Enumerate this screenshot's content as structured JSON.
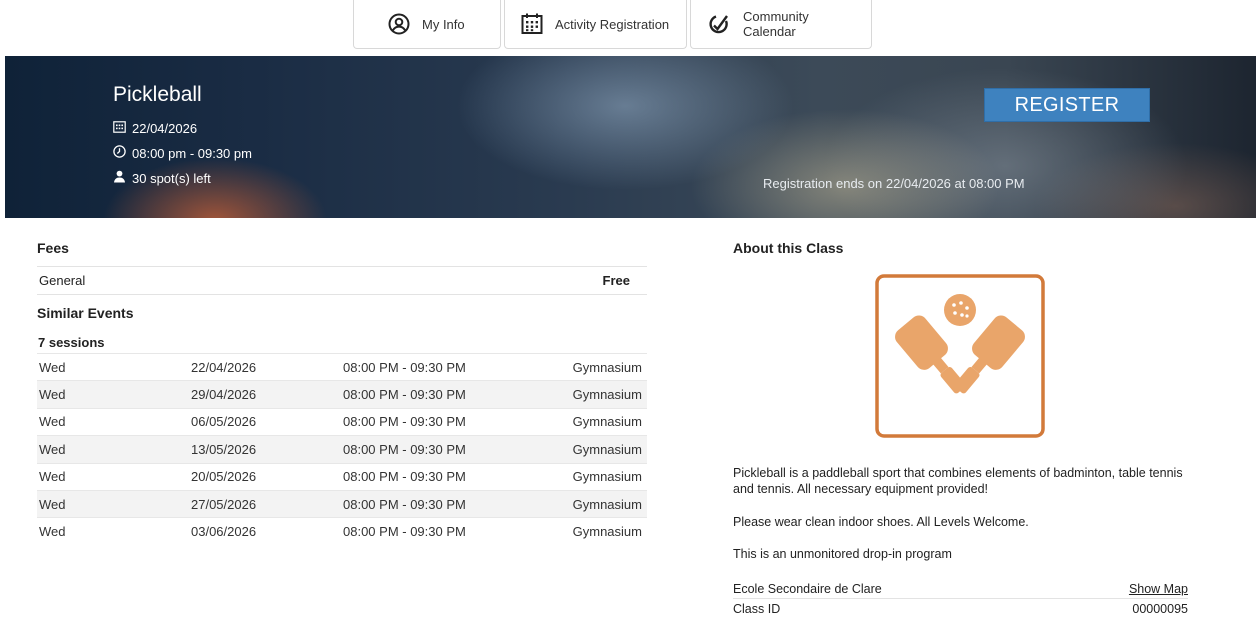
{
  "nav": {
    "tabs": [
      {
        "label": "My Info",
        "icon": "user-circle-icon"
      },
      {
        "label": "Activity Registration",
        "icon": "calendar-grid-icon"
      },
      {
        "label": "Community Calendar",
        "icon": "community-logo-icon"
      }
    ]
  },
  "hero": {
    "title": "Pickleball",
    "date": "22/04/2026",
    "time": "08:00 pm - 09:30 pm",
    "spots": "30 spot(s) left",
    "register_label": "REGISTER",
    "registration_ends": "Registration ends on 22/04/2026 at 08:00 PM"
  },
  "fees": {
    "heading": "Fees",
    "rows": [
      {
        "name": "General",
        "price": "Free"
      }
    ]
  },
  "similar": {
    "heading": "Similar Events",
    "sessions_label": "7 sessions",
    "rows": [
      {
        "day": "Wed",
        "date": "22/04/2026",
        "time": "08:00 PM - 09:30 PM",
        "location": "Gymnasium"
      },
      {
        "day": "Wed",
        "date": "29/04/2026",
        "time": "08:00 PM - 09:30 PM",
        "location": "Gymnasium"
      },
      {
        "day": "Wed",
        "date": "06/05/2026",
        "time": "08:00 PM - 09:30 PM",
        "location": "Gymnasium"
      },
      {
        "day": "Wed",
        "date": "13/05/2026",
        "time": "08:00 PM - 09:30 PM",
        "location": "Gymnasium"
      },
      {
        "day": "Wed",
        "date": "20/05/2026",
        "time": "08:00 PM - 09:30 PM",
        "location": "Gymnasium"
      },
      {
        "day": "Wed",
        "date": "27/05/2026",
        "time": "08:00 PM - 09:30 PM",
        "location": "Gymnasium"
      },
      {
        "day": "Wed",
        "date": "03/06/2026",
        "time": "08:00 PM - 09:30 PM",
        "location": "Gymnasium"
      }
    ]
  },
  "about": {
    "heading": "About this Class",
    "image_icon": "pickleball-paddles-icon",
    "description": [
      "Pickleball is a paddleball sport that combines elements of badminton, table tennis and tennis. All necessary equipment provided!",
      "Please wear clean indoor shoes. All Levels Welcome.",
      "This is an unmonitored drop-in program"
    ],
    "location": "Ecole Secondaire de Clare",
    "show_map_label": "Show Map",
    "class_id_label": "Class ID",
    "class_id": "00000095"
  },
  "colors": {
    "register_button": "#3e82bf",
    "logo_orange": "#d27a3a",
    "logo_fill": "#e9a56a"
  }
}
